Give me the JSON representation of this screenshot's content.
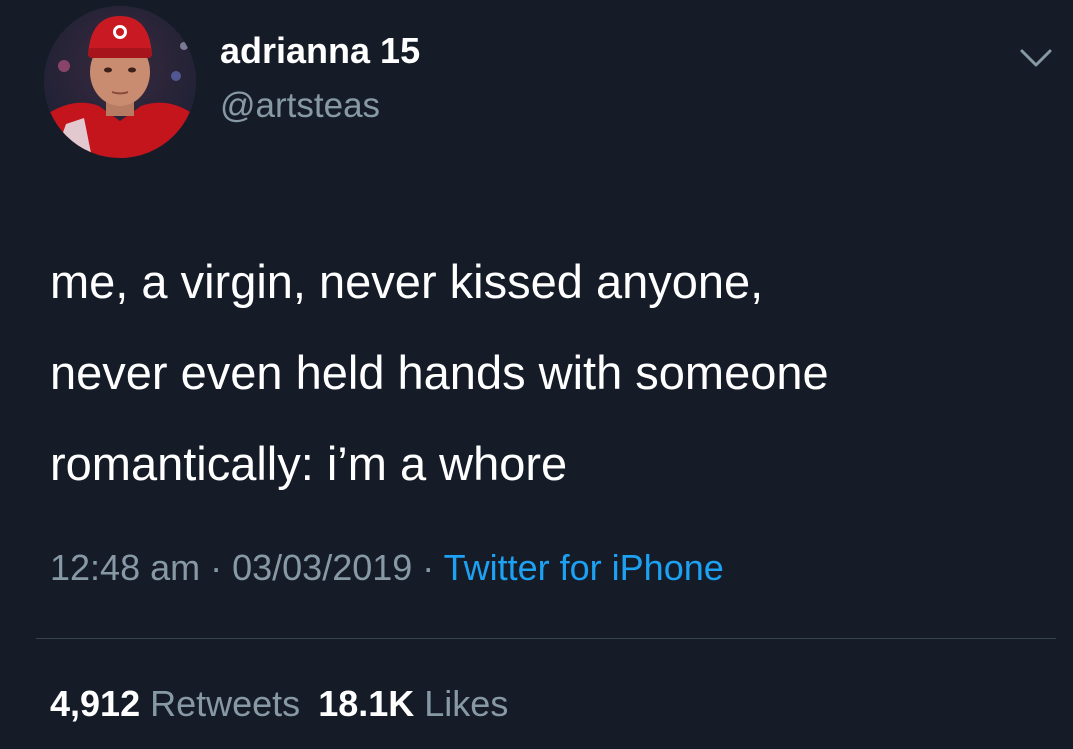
{
  "author": {
    "display_name": "adrianna 15",
    "handle": "@artsteas",
    "avatar_icon": "profile-photo"
  },
  "tweet": {
    "lines": [
      "me, a virgin, never kissed anyone,",
      "never even held hands with someone",
      "romantically: i’m a whore"
    ]
  },
  "meta": {
    "time": "12:48 am",
    "separator": " · ",
    "date": "03/03/2019",
    "separator2": " · ",
    "source": "Twitter for iPhone"
  },
  "stats": {
    "retweets_count": "4,912",
    "retweets_label": "Retweets",
    "likes_count": "18.1K",
    "likes_label": "Likes"
  },
  "colors": {
    "background": "#151c28",
    "text_primary": "#ffffff",
    "text_secondary": "#8899a6",
    "link": "#1da1f2",
    "divider": "#38444d"
  },
  "icons": {
    "menu": "chevron-down-icon"
  }
}
